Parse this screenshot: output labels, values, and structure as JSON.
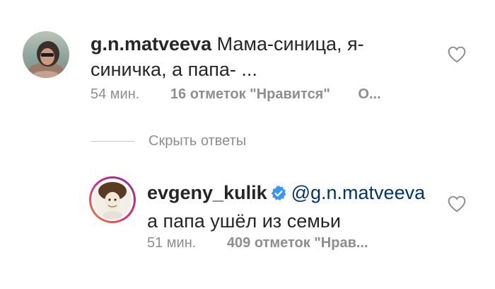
{
  "comment": {
    "username": "g.n.matveeva",
    "text_line1": "Мама-синица, я-",
    "text_line2": "синичка, а папа- ...",
    "time": "54 мин.",
    "likes": "16 отметок \"Нравится\"",
    "reply_label": "О..."
  },
  "replies_toggle": {
    "label": "Скрыть ответы"
  },
  "reply": {
    "username": "evgeny_kulik",
    "mention": "@g.n.matveeva",
    "text": "а папа ушёл из семьи",
    "time": "51 мин.",
    "likes": "409 отметок \"Нрав..."
  },
  "icons": {
    "heart": "heart-outline-icon",
    "verified": "verified-badge-icon"
  },
  "colors": {
    "text": "#262626",
    "meta": "#8e8e8e",
    "mention": "#003569",
    "verified": "#3897f0",
    "story_ring_start": "#f58529",
    "story_ring_end": "#dd2a7b"
  }
}
